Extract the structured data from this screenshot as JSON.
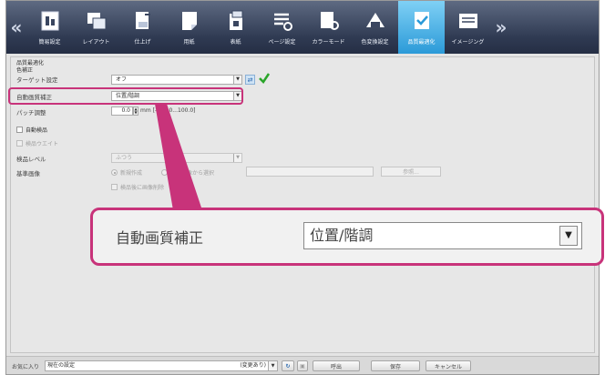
{
  "toolbar": {
    "left_arrow": "«",
    "right_arrow": "»",
    "items": [
      {
        "label": "簡易設定",
        "icon": "quick-setting-icon"
      },
      {
        "label": "レイアウト",
        "icon": "layout-icon"
      },
      {
        "label": "仕上げ",
        "icon": "finishing-icon"
      },
      {
        "label": "用紙",
        "icon": "paper-icon"
      },
      {
        "label": "表紙",
        "icon": "cover-icon"
      },
      {
        "label": "ページ設定",
        "icon": "page-setting-icon"
      },
      {
        "label": "カラーモード",
        "icon": "color-mode-icon"
      },
      {
        "label": "色変換設定",
        "icon": "color-conversion-icon"
      },
      {
        "label": "品質最適化",
        "icon": "quality-optimize-icon",
        "active": true
      },
      {
        "label": "イメージング",
        "icon": "imaging-icon"
      }
    ]
  },
  "panel": {
    "section_title": "品質最適化",
    "sub_title": "色補正",
    "target_label": "ターゲット設定",
    "target_value": "オフ",
    "auto_quality_label": "自動画質補正",
    "auto_quality_value": "位置/階調",
    "patch_label": "パッチ調整",
    "patch_value": "0.0",
    "patch_range": "mm [-100.0...100.0]",
    "auto_check_label": "自動検品",
    "check_wait_label": "検品ウエイト",
    "check_level_label": "検品レベル",
    "check_level_value": "ふつう",
    "reference_label": "基準画像",
    "radio_new": "新規作成",
    "radio_existing": "基準画像から選択",
    "ref_button": "参照...",
    "save_after_check": "検品後に画像削除"
  },
  "zoom": {
    "label": "自動画質補正",
    "value": "位置/階調"
  },
  "bottom": {
    "favorites_label": "お気に入り",
    "favorites_value": "現在の設定",
    "favorites_state": "(変更あり)",
    "call_button": "呼出",
    "save_button": "保存",
    "cancel_button": "キャンセル"
  },
  "colors": {
    "accent_magenta": "#c8337a",
    "toolbar_dark": "#2f3a52",
    "active_tab": "#2b9ad8",
    "ok_green": "#2aa52a"
  }
}
